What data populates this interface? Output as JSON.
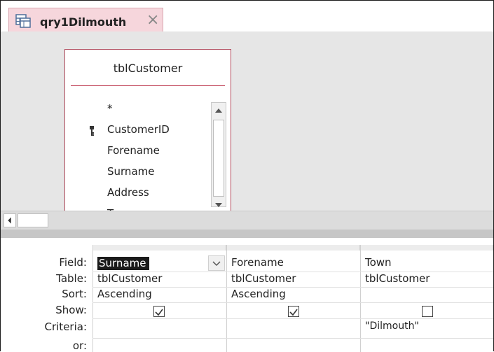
{
  "tab": {
    "label": "qry1Dilmouth",
    "icon": "query-icon",
    "close_icon": "close-icon"
  },
  "field_list": {
    "title": "tblCustomer",
    "items": [
      "*",
      "CustomerID",
      "Forename",
      "Surname",
      "Address",
      "Town"
    ],
    "primary_key": "CustomerID"
  },
  "grid": {
    "row_labels": [
      "Field:",
      "Table:",
      "Sort:",
      "Show:",
      "Criteria:",
      "or:"
    ],
    "columns": [
      {
        "field": "Surname",
        "table": "tblCustomer",
        "sort": "Ascending",
        "show": true,
        "criteria": ""
      },
      {
        "field": "Forename",
        "table": "tblCustomer",
        "sort": "Ascending",
        "show": true,
        "criteria": ""
      },
      {
        "field": "Town",
        "table": "tblCustomer",
        "sort": "",
        "show": false,
        "criteria": "\"Dilmouth\""
      }
    ]
  },
  "colors": {
    "tab_bg": "#f6d6dc",
    "table_border": "#b04a5c",
    "pane_bg": "#e6e6e6"
  }
}
